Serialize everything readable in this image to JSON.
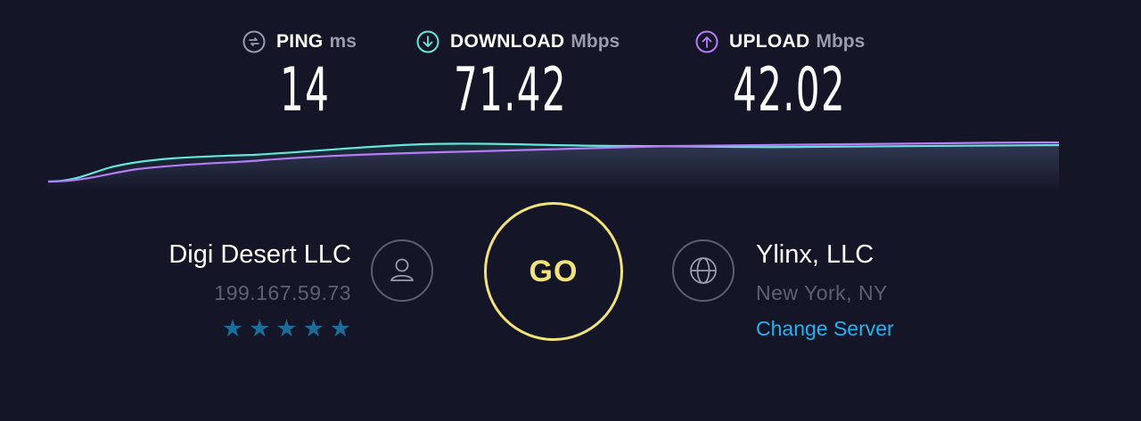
{
  "metrics": {
    "ping": {
      "label": "PING",
      "unit": "ms",
      "value": "14",
      "icon": "ping-icon",
      "color": "#9a9bab"
    },
    "download": {
      "label": "DOWNLOAD",
      "unit": "Mbps",
      "value": "71.42",
      "icon": "download-arrow-icon",
      "color": "#64e6da"
    },
    "upload": {
      "label": "UPLOAD",
      "unit": "Mbps",
      "value": "42.02",
      "icon": "upload-arrow-icon",
      "color": "#b57cf7"
    }
  },
  "graph": {
    "download_color": "#64e6da",
    "upload_color": "#b57cf7"
  },
  "isp": {
    "name": "Digi Desert LLC",
    "ip": "199.167.59.73",
    "rating": 5,
    "rating_max": 5,
    "icon": "user-icon"
  },
  "go_button": {
    "label": "GO",
    "color": "#f1e27a"
  },
  "server": {
    "name": "Ylinx, LLC",
    "location": "New York, NY",
    "change_label": "Change Server",
    "icon": "globe-icon",
    "link_color": "#1fb3f2"
  },
  "colors": {
    "background": "#141526",
    "star": "#1b6c99"
  }
}
